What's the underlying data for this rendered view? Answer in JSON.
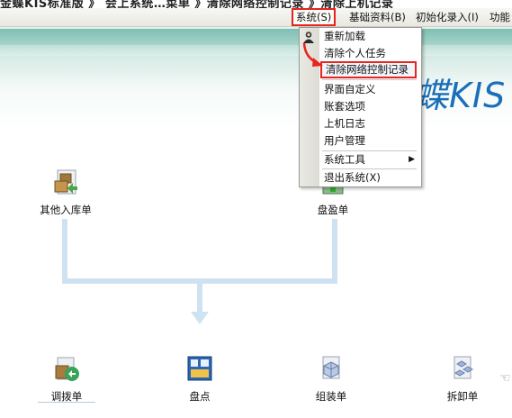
{
  "caption": "金蝶KIS标准版 》 会上系统…菜单 》清除网络控制记录 》清除上机记录",
  "menubar": {
    "items": [
      {
        "label": "系统(S)",
        "active": true
      },
      {
        "label": "基础资料(B)",
        "active": false
      },
      {
        "label": "初始化录入(I)",
        "active": false
      },
      {
        "label": "功能",
        "active": false
      }
    ]
  },
  "logo": "蝶KIS",
  "dropdown": {
    "items": [
      {
        "label": "重新加载",
        "icon": "person-icon"
      },
      {
        "label": "清除个人任务"
      },
      {
        "label": "清除网络控制记录",
        "highlighted": true
      },
      {
        "label": "界面自定义"
      },
      {
        "label": "账套选项"
      },
      {
        "label": "上机日志"
      },
      {
        "label": "用户管理"
      },
      {
        "label": "系统工具",
        "submenu": true
      },
      {
        "label": "退出系统(X)"
      }
    ]
  },
  "workflow": {
    "top_nodes": [
      {
        "label": "其他入库单",
        "icon": "inbound-box-icon"
      },
      {
        "label": "盘盈单",
        "icon": "inventory-gain-icon"
      }
    ],
    "bottom_nodes": [
      {
        "label": "调拨单",
        "icon": "transfer-box-icon"
      },
      {
        "label": "盘点",
        "icon": "stocktake-icon"
      },
      {
        "label": "组装单",
        "icon": "assembly-cube-icon"
      },
      {
        "label": "拆卸单",
        "icon": "disassembly-cube-icon"
      }
    ]
  },
  "colors": {
    "highlight_border": "#e8241d",
    "banner_green": "#7fbfb3",
    "logo_blue": "#1a6fb8",
    "flow_line": "#cfe2f1"
  }
}
